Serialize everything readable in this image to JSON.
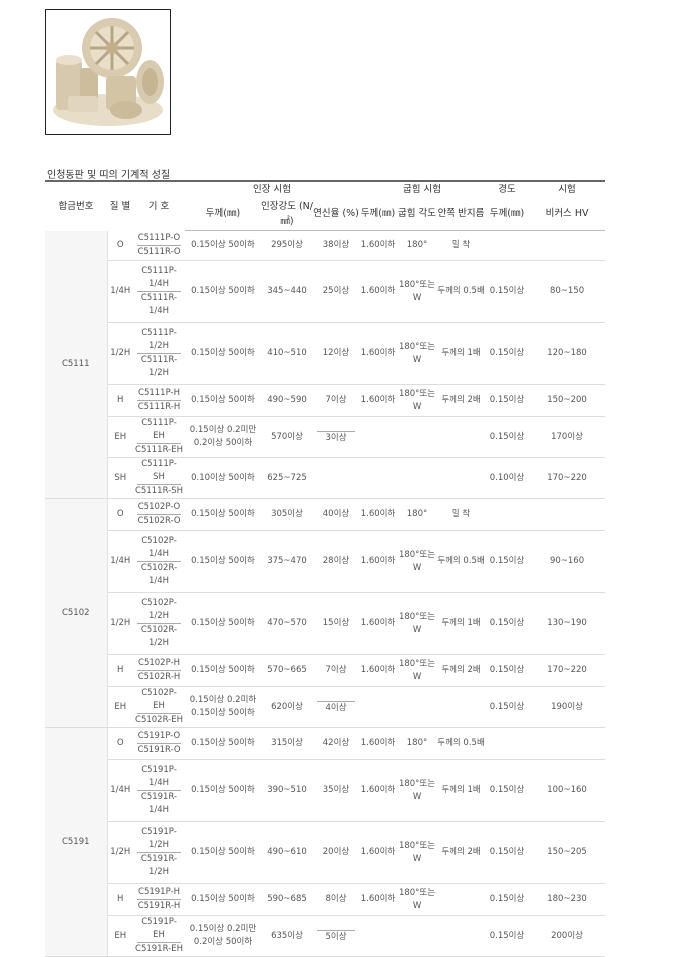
{
  "caption": "인청동판 및 띠의 기계적 성질",
  "header": {
    "alloy": "합금번호",
    "temper": "질 별",
    "symbol": "기 호",
    "tensile": "인장 시험",
    "bend": "굽힘 시험",
    "hardness": "경도",
    "hardtest": "시험",
    "thickness": "두께(㎜)",
    "strength": "인장강도 (N/㎟)",
    "elongation": "연신율 (%)",
    "bend_thickness": "두께(㎜)",
    "bend_angle": "굽힘 각도",
    "inner_radius": "안쪽 반지름",
    "hard_thickness": "두께(㎜)",
    "vickers": "비커스 HV"
  },
  "groups": [
    {
      "alloy": "C5111",
      "rows": [
        {
          "temper": "O",
          "sym1": "C5111P-O",
          "sym2": "C5111R-O",
          "thick": "0.15이상 50이하",
          "strength": "295이상",
          "elong": "38이상",
          "bthick": "1.60이하",
          "angle": "180°",
          "radius": "밀 착",
          "hthick": "",
          "hv": ""
        },
        {
          "temper": "1/4H",
          "sym1": "C5111P-1/4H",
          "sym2": "C5111R-1/4H",
          "thick": "0.15이상 50이하",
          "strength": "345~440",
          "elong": "25이상",
          "bthick": "1.60이하",
          "angle": "180°또는 W",
          "radius": "두께의 0.5배",
          "hthick": "0.15이상",
          "hv": "80~150"
        },
        {
          "temper": "1/2H",
          "sym1": "C5111P-1/2H",
          "sym2": "C5111R-1/2H",
          "thick": "0.15이상 50이하",
          "strength": "410~510",
          "elong": "12이상",
          "bthick": "1.60이하",
          "angle": "180°또는 W",
          "radius": "두께의 1배",
          "hthick": "0.15이상",
          "hv": "120~180"
        },
        {
          "temper": "H",
          "sym1": "C5111P-H",
          "sym2": "C5111R-H",
          "thick": "0.15이상 50이하",
          "strength": "490~590",
          "elong": "7이상",
          "bthick": "1.60이하",
          "angle": "180°또는 W",
          "radius": "두께의 2배",
          "hthick": "0.15이상",
          "hv": "150~200"
        },
        {
          "temper": "EH",
          "sym1": "C5111P-EH",
          "sym2": "C5111R-EH",
          "thick": "0.15이상 0.2미만",
          "thick2": "0.2이상 50이하",
          "strength": "570이상",
          "elong": "",
          "elong2": "3이상",
          "bthick": "",
          "angle": "",
          "radius": "",
          "hthick": "0.15이상",
          "hv": "170이상"
        },
        {
          "temper": "SH",
          "sym1": "C5111P-SH",
          "sym2": "C5111R-SH",
          "thick": "0.10이상 50이하",
          "strength": "625~725",
          "elong": "",
          "bthick": "",
          "angle": "",
          "radius": "",
          "hthick": "0.10이상",
          "hv": "170~220"
        }
      ]
    },
    {
      "alloy": "C5102",
      "rows": [
        {
          "temper": "O",
          "sym1": "C5102P-O",
          "sym2": "C5102R-O",
          "thick": "0.15이상 50이하",
          "strength": "305이상",
          "elong": "40이상",
          "bthick": "1.60이하",
          "angle": "180°",
          "radius": "밀 착",
          "hthick": "",
          "hv": ""
        },
        {
          "temper": "1/4H",
          "sym1": "C5102P-1/4H",
          "sym2": "C5102R-1/4H",
          "thick": "0.15이상 50이하",
          "strength": "375~470",
          "elong": "28이상",
          "bthick": "1.60이하",
          "angle": "180°또는 W",
          "radius": "두께의 0.5배",
          "hthick": "0.15이상",
          "hv": "90~160"
        },
        {
          "temper": "1/2H",
          "sym1": "C5102P-1/2H",
          "sym2": "C5102R-1/2H",
          "thick": "0.15이상 50이하",
          "strength": "470~570",
          "elong": "15이상",
          "bthick": "1.60이하",
          "angle": "180°또는 W",
          "radius": "두께의 1배",
          "hthick": "0.15이상",
          "hv": "130~190"
        },
        {
          "temper": "H",
          "sym1": "C5102P-H",
          "sym2": "C5102R-H",
          "thick": "0.15이상 50이하",
          "strength": "570~665",
          "elong": "7이상",
          "bthick": "1.60이하",
          "angle": "180°또는 W",
          "radius": "두께의 2배",
          "hthick": "0.15이상",
          "hv": "170~220"
        },
        {
          "temper": "EH",
          "sym1": "C5102P-EH",
          "sym2": "C5102R-EH",
          "thick": "0.15이상 0.2미하",
          "thick2": "0.15이상 50이하",
          "strength": "620이상",
          "elong": "",
          "elong2": "4이상",
          "bthick": "",
          "angle": "",
          "radius": "",
          "hthick": "0.15이상",
          "hv": "190이상"
        }
      ]
    },
    {
      "alloy": "C5191",
      "rows": [
        {
          "temper": "O",
          "sym1": "C5191P-O",
          "sym2": "C5191R-O",
          "thick": "0.15이상 50이하",
          "strength": "315이상",
          "elong": "42이상",
          "bthick": "1.60이하",
          "angle": "180°",
          "radius": "두께의 0.5배",
          "hthick": "",
          "hv": ""
        },
        {
          "temper": "1/4H",
          "sym1": "C5191P-1/4H",
          "sym2": "C5191R-1/4H",
          "thick": "0.15이상 50이하",
          "strength": "390~510",
          "elong": "35이상",
          "bthick": "1.60이하",
          "angle": "180°또는 W",
          "radius": "두께의 1배",
          "hthick": "0.15이상",
          "hv": "100~160"
        },
        {
          "temper": "1/2H",
          "sym1": "C5191P-1/2H",
          "sym2": "C5191R-1/2H",
          "thick": "0.15이상 50이하",
          "strength": "490~610",
          "elong": "20이상",
          "bthick": "1.60이하",
          "angle": "180°또는 W",
          "radius": "두께의 2배",
          "hthick": "0.15이상",
          "hv": "150~205"
        },
        {
          "temper": "H",
          "sym1": "C5191P-H",
          "sym2": "C5191R-H",
          "thick": "0.15이상 50이하",
          "strength": "590~685",
          "elong": "8이상",
          "bthick": "1.60이하",
          "angle": "180°또는 W",
          "radius": "",
          "hthick": "0.15이상",
          "hv": "180~230"
        },
        {
          "temper": "EH",
          "sym1": "C5191P-EH",
          "sym2": "C5191R-EH",
          "thick": "0.15이상 0.2미만",
          "thick2": "0.2이상 50이하",
          "strength": "635이상",
          "elong": "",
          "elong2": "5이상",
          "bthick": "",
          "angle": "",
          "radius": "",
          "hthick": "0.15이상",
          "hv": "200이상"
        }
      ]
    }
  ]
}
